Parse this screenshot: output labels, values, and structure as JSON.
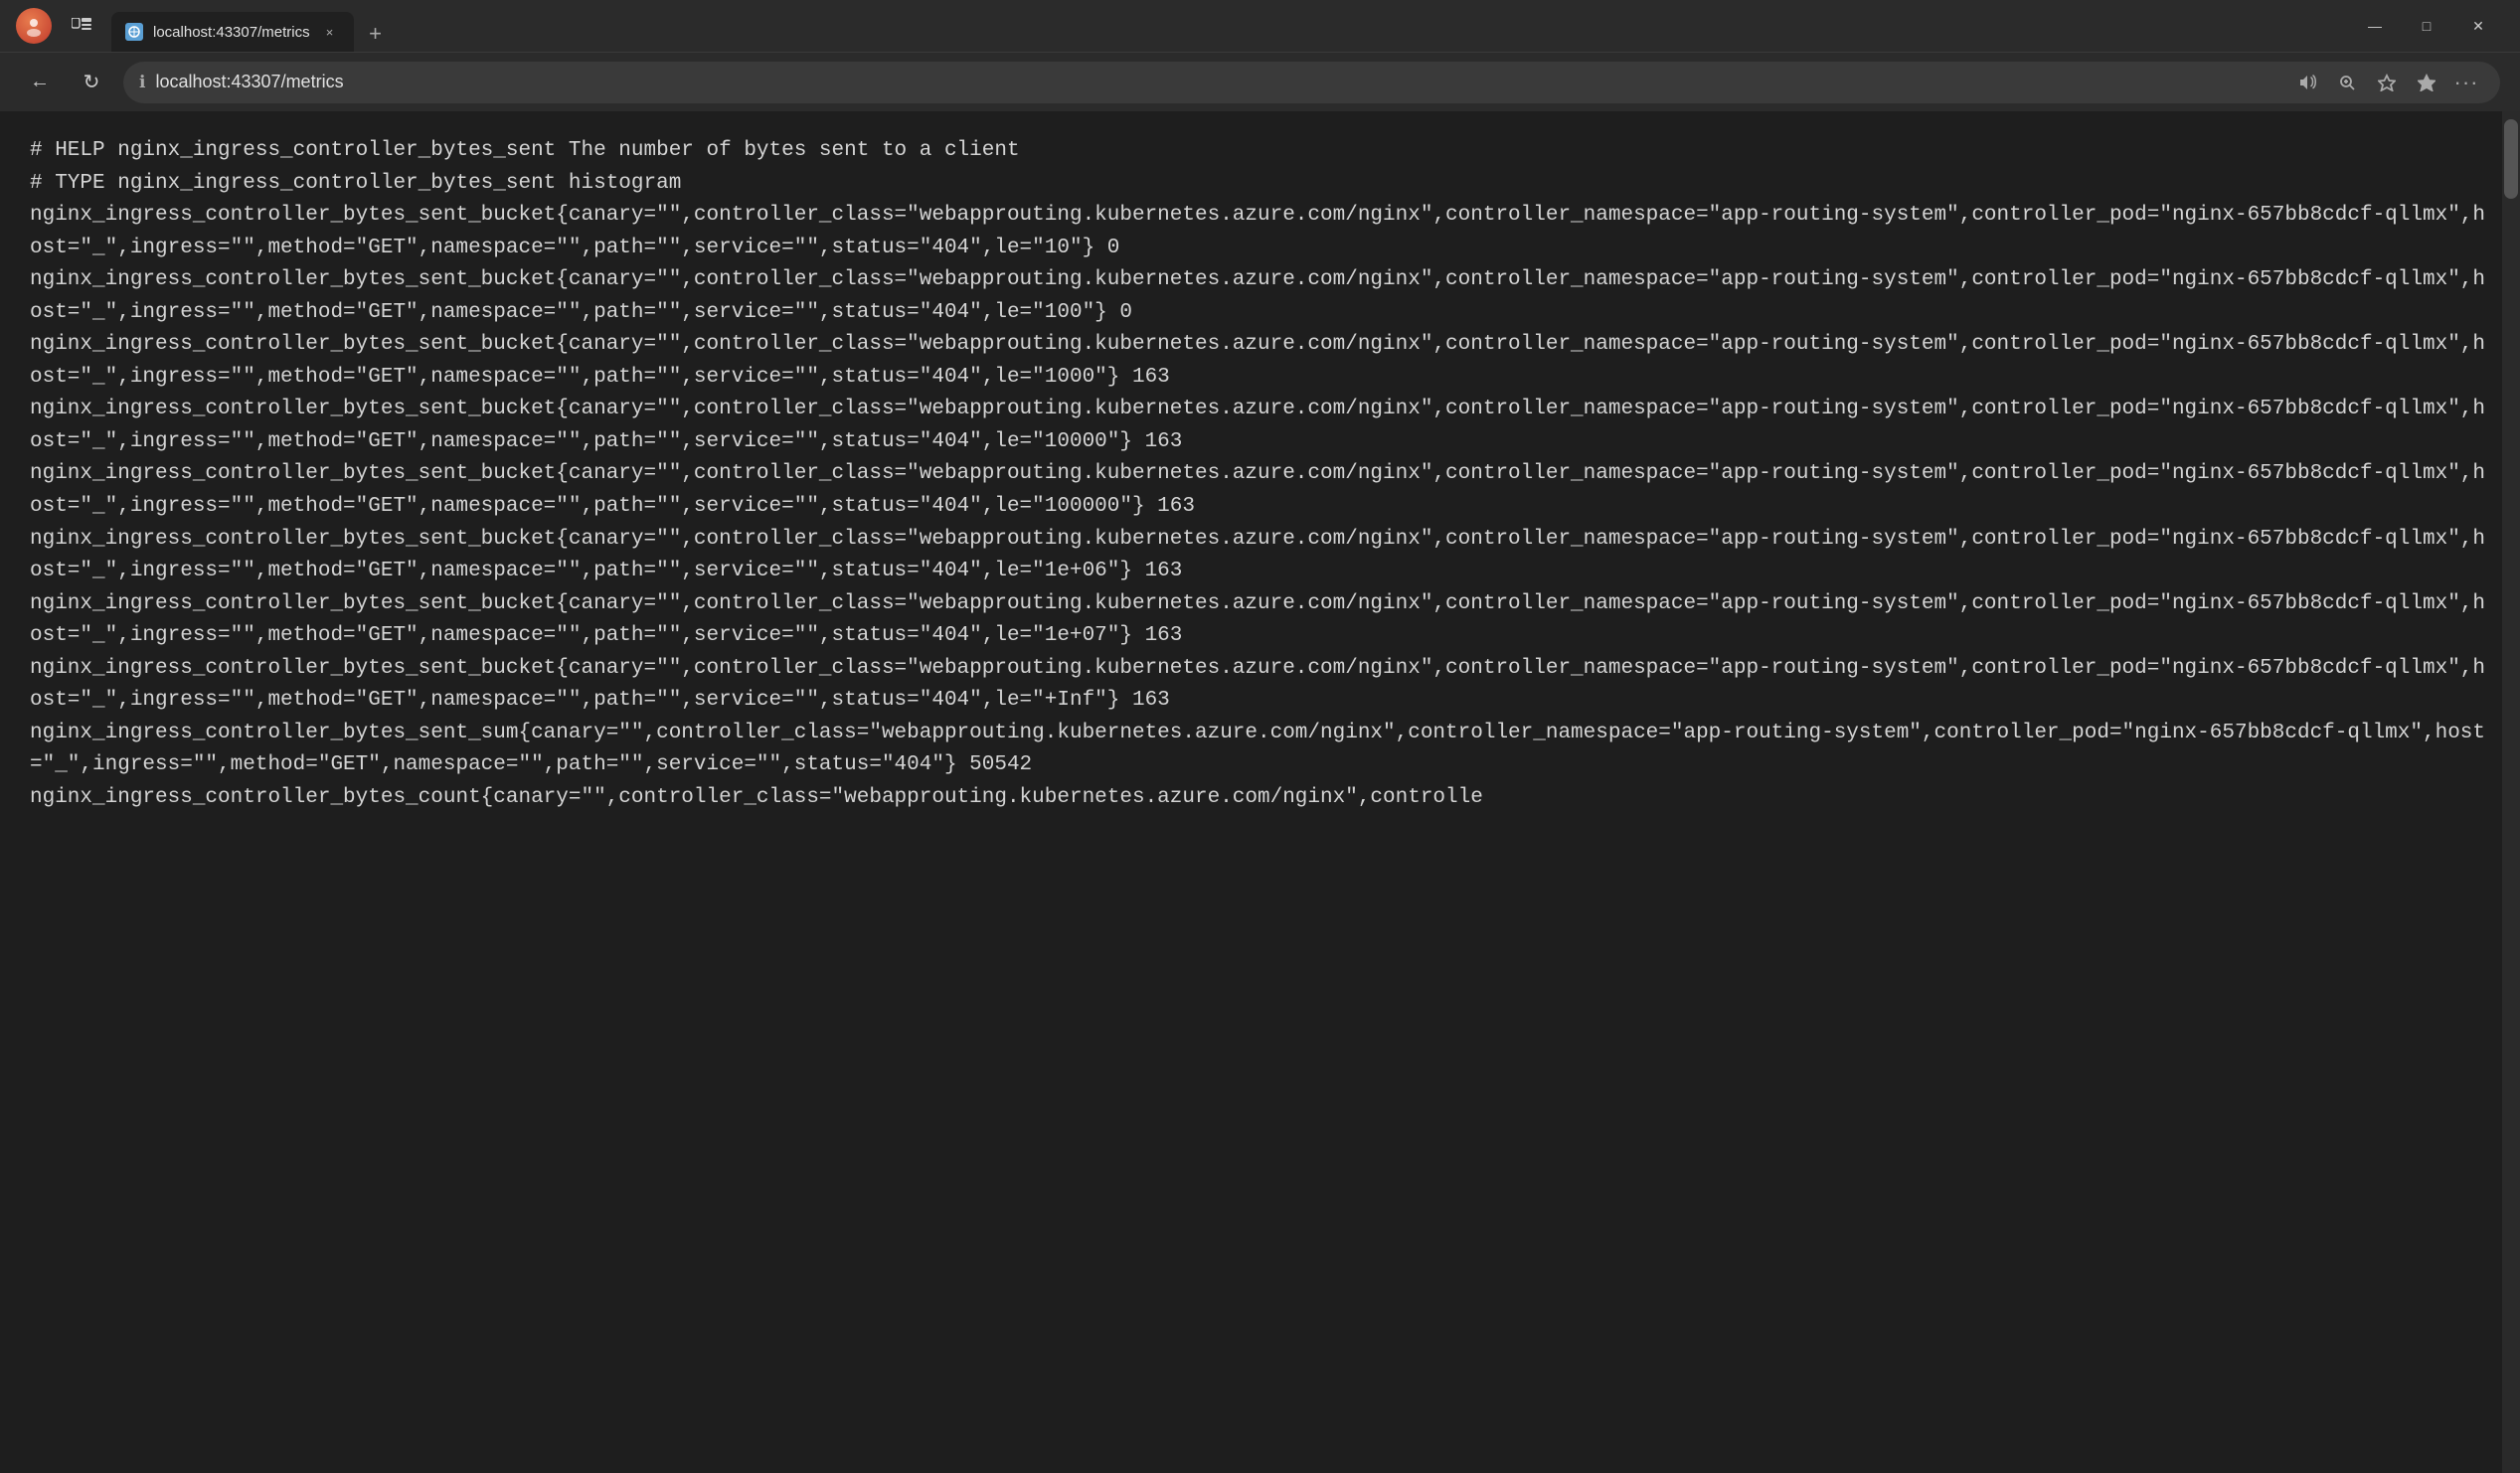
{
  "titlebar": {
    "tab": {
      "favicon_text": "🌐",
      "title": "localhost:43307/metrics",
      "close_label": "×"
    },
    "new_tab_label": "+",
    "controls": {
      "minimize": "—",
      "maximize": "□",
      "close": "✕"
    }
  },
  "addressbar": {
    "back_icon": "←",
    "refresh_icon": "↻",
    "info_icon": "ℹ",
    "url": "localhost:43307/metrics",
    "read_aloud_icon": "🔊",
    "zoom_icon": "🔍",
    "favorites_icon": "☆",
    "collections_icon": "★",
    "more_icon": "···"
  },
  "content": {
    "lines": [
      "# HELP nginx_ingress_controller_bytes_sent The number of bytes sent to a client",
      "# TYPE nginx_ingress_controller_bytes_sent histogram",
      "nginx_ingress_controller_bytes_sent_bucket{canary=\"\",controller_class=\"webapprouting.kubernetes.azure.com/nginx\",controller_namespace=\"app-routing-system\",controller_pod=\"nginx-657bb8cdcf-qllmx\",host=\"_\",ingress=\"\",method=\"GET\",namespace=\"\",path=\"\",service=\"\",status=\"404\",le=\"10\"} 0",
      "nginx_ingress_controller_bytes_sent_bucket{canary=\"\",controller_class=\"webapprouting.kubernetes.azure.com/nginx\",controller_namespace=\"app-routing-system\",controller_pod=\"nginx-657bb8cdcf-qllmx\",host=\"_\",ingress=\"\",method=\"GET\",namespace=\"\",path=\"\",service=\"\",status=\"404\",le=\"100\"} 0",
      "nginx_ingress_controller_bytes_sent_bucket{canary=\"\",controller_class=\"webapprouting.kubernetes.azure.com/nginx\",controller_namespace=\"app-routing-system\",controller_pod=\"nginx-657bb8cdcf-qllmx\",host=\"_\",ingress=\"\",method=\"GET\",namespace=\"\",path=\"\",service=\"\",status=\"404\",le=\"1000\"} 163",
      "nginx_ingress_controller_bytes_sent_bucket{canary=\"\",controller_class=\"webapprouting.kubernetes.azure.com/nginx\",controller_namespace=\"app-routing-system\",controller_pod=\"nginx-657bb8cdcf-qllmx\",host=\"_\",ingress=\"\",method=\"GET\",namespace=\"\",path=\"\",service=\"\",status=\"404\",le=\"10000\"} 163",
      "nginx_ingress_controller_bytes_sent_bucket{canary=\"\",controller_class=\"webapprouting.kubernetes.azure.com/nginx\",controller_namespace=\"app-routing-system\",controller_pod=\"nginx-657bb8cdcf-qllmx\",host=\"_\",ingress=\"\",method=\"GET\",namespace=\"\",path=\"\",service=\"\",status=\"404\",le=\"100000\"} 163",
      "nginx_ingress_controller_bytes_sent_bucket{canary=\"\",controller_class=\"webapprouting.kubernetes.azure.com/nginx\",controller_namespace=\"app-routing-system\",controller_pod=\"nginx-657bb8cdcf-qllmx\",host=\"_\",ingress=\"\",method=\"GET\",namespace=\"\",path=\"\",service=\"\",status=\"404\",le=\"1e+06\"} 163",
      "nginx_ingress_controller_bytes_sent_bucket{canary=\"\",controller_class=\"webapprouting.kubernetes.azure.com/nginx\",controller_namespace=\"app-routing-system\",controller_pod=\"nginx-657bb8cdcf-qllmx\",host=\"_\",ingress=\"\",method=\"GET\",namespace=\"\",path=\"\",service=\"\",status=\"404\",le=\"1e+07\"} 163",
      "nginx_ingress_controller_bytes_sent_bucket{canary=\"\",controller_class=\"webapprouting.kubernetes.azure.com/nginx\",controller_namespace=\"app-routing-system\",controller_pod=\"nginx-657bb8cdcf-qllmx\",host=\"_\",ingress=\"\",method=\"GET\",namespace=\"\",path=\"\",service=\"\",status=\"404\",le=\"+Inf\"} 163",
      "nginx_ingress_controller_bytes_sent_sum{canary=\"\",controller_class=\"webapprouting.kubernetes.azure.com/nginx\",controller_namespace=\"app-routing-system\",controller_pod=\"nginx-657bb8cdcf-qllmx\",host=\"_\",ingress=\"\",method=\"GET\",namespace=\"\",path=\"\",service=\"\",status=\"404\"} 50542",
      "nginx_ingress_controller_bytes_count{canary=\"\",controller_class=\"webapprouting.kubernetes.azure.com/nginx\",controlle"
    ]
  }
}
